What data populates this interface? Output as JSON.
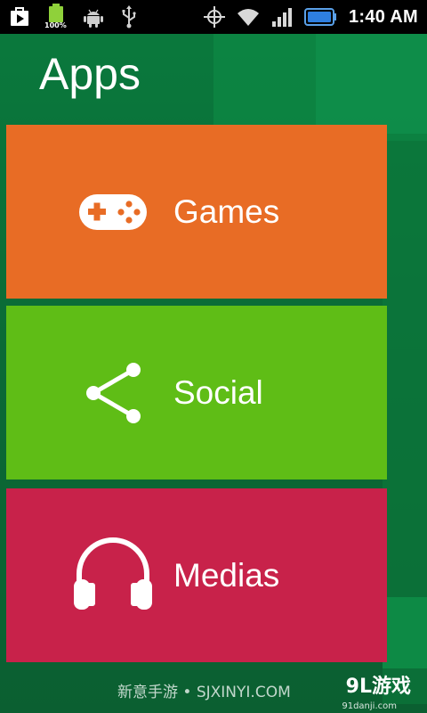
{
  "status_bar": {
    "battery_label": "100%",
    "time": "1:40 AM"
  },
  "header": {
    "title": "Apps"
  },
  "tiles": [
    {
      "label": "Games",
      "icon": "gamepad-icon",
      "color": "#e86c25"
    },
    {
      "label": "Social",
      "icon": "share-icon",
      "color": "#5fbd16"
    },
    {
      "label": "Medias",
      "icon": "headphones-icon",
      "color": "#c8224a"
    }
  ],
  "watermark": {
    "text": "新意手游 • SJXINYI.COM",
    "logo": "9L游戏",
    "logo_sub": "91danji.com"
  },
  "colors": {
    "background": "#0b6a36",
    "status_bar": "#000000"
  }
}
